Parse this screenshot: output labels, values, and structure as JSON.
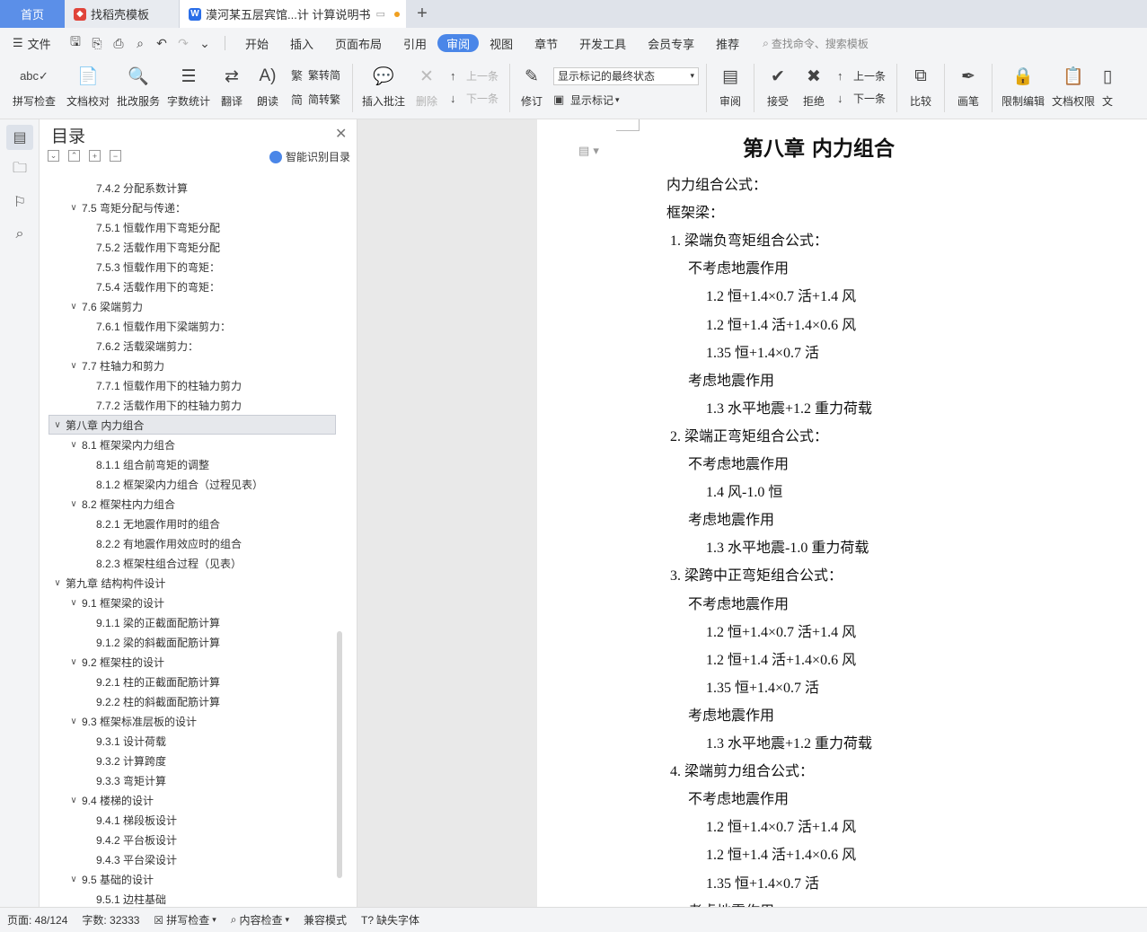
{
  "tabs": {
    "home": "首页",
    "t2": "找稻壳模板",
    "t3": "漠河某五层宾馆...计 计算说明书"
  },
  "menu": {
    "file": "文件",
    "items": [
      "开始",
      "插入",
      "页面布局",
      "引用",
      "审阅",
      "视图",
      "章节",
      "开发工具",
      "会员专享",
      "推荐"
    ],
    "active": "审阅",
    "search": "查找命令、搜索模板"
  },
  "ribbon": {
    "spell": "拼写检查",
    "proof": "文档校对",
    "batch": "批改服务",
    "wordcount": "字数统计",
    "translate": "翻译",
    "read": "朗读",
    "trad": "繁转简",
    "simp": "简转繁",
    "insert_comment": "插入批注",
    "delete": "删除",
    "prev": "上一条",
    "next": "下一条",
    "track": "修订",
    "markup_state": "显示标记的最终状态",
    "show_markup": "显示标记",
    "review": "审阅",
    "accept": "接受",
    "reject": "拒绝",
    "prev2": "上一条",
    "next2": "下一条",
    "compare": "比较",
    "pen": "画笔",
    "restrict": "限制编辑",
    "rights": "文档权限",
    "doc": "文"
  },
  "toc": {
    "title": "目录",
    "smart": "智能识别目录",
    "entries": [
      {
        "level": 3,
        "text": "7.4.2 分配系数计算"
      },
      {
        "level": 2,
        "text": "7.5 弯矩分配与传递："
      },
      {
        "level": 3,
        "text": "7.5.1 恒载作用下弯矩分配"
      },
      {
        "level": 3,
        "text": "7.5.2 活载作用下弯矩分配"
      },
      {
        "level": 3,
        "text": "7.5.3 恒载作用下的弯矩："
      },
      {
        "level": 3,
        "text": "7.5.4 活载作用下的弯矩："
      },
      {
        "level": 2,
        "text": "7.6 梁端剪力"
      },
      {
        "level": 3,
        "text": "7.6.1 恒载作用下梁端剪力："
      },
      {
        "level": 3,
        "text": "7.6.2 活载梁端剪力："
      },
      {
        "level": 2,
        "text": "7.7 柱轴力和剪力"
      },
      {
        "level": 3,
        "text": "7.7.1 恒载作用下的柱轴力剪力"
      },
      {
        "level": 3,
        "text": "7.7.2 活载作用下的柱轴力剪力"
      },
      {
        "level": 1,
        "text": "第八章  内力组合",
        "active": true
      },
      {
        "level": 2,
        "text": "8.1 框架梁内力组合"
      },
      {
        "level": 3,
        "text": "8.1.1 组合前弯矩的调整"
      },
      {
        "level": 3,
        "text": "8.1.2 框架梁内力组合（过程见表）"
      },
      {
        "level": 2,
        "text": "8.2 框架柱内力组合"
      },
      {
        "level": 3,
        "text": "8.2.1 无地震作用时的组合"
      },
      {
        "level": 3,
        "text": "8.2.2 有地震作用效应时的组合"
      },
      {
        "level": 3,
        "text": "8.2.3 框架柱组合过程（见表）"
      },
      {
        "level": 1,
        "text": "第九章  结构构件设计"
      },
      {
        "level": 2,
        "text": "9.1 框架梁的设计"
      },
      {
        "level": 3,
        "text": "9.1.1 梁的正截面配筋计算"
      },
      {
        "level": 3,
        "text": "9.1.2 梁的斜截面配筋计算"
      },
      {
        "level": 2,
        "text": "9.2 框架柱的设计"
      },
      {
        "level": 3,
        "text": "9.2.1 柱的正截面配筋计算"
      },
      {
        "level": 3,
        "text": "9.2.2 柱的斜截面配筋计算"
      },
      {
        "level": 2,
        "text": "9.3 框架标准层板的设计"
      },
      {
        "level": 3,
        "text": "9.3.1 设计荷载"
      },
      {
        "level": 3,
        "text": "9.3.2 计算跨度"
      },
      {
        "level": 3,
        "text": "9.3.3 弯矩计算"
      },
      {
        "level": 2,
        "text": "9.4 楼梯的设计"
      },
      {
        "level": 3,
        "text": "9.4.1 梯段板设计"
      },
      {
        "level": 3,
        "text": "9.4.2 平台板设计"
      },
      {
        "level": 3,
        "text": "9.4.3 平台梁设计"
      },
      {
        "level": 2,
        "text": " 9.5 基础的设计"
      },
      {
        "level": 3,
        "text": "9.5.1 边柱基础"
      }
    ]
  },
  "doc": {
    "heading": "第八章  内力组合",
    "lines": [
      {
        "indent": 0,
        "text": "内力组合公式："
      },
      {
        "indent": 0,
        "text": "框架梁："
      },
      {
        "indent": 1,
        "text": "1.  梁端负弯矩组合公式："
      },
      {
        "indent": 2,
        "text": "不考虑地震作用"
      },
      {
        "indent": 3,
        "text": "1.2 恒+1.4×0.7 活+1.4 风"
      },
      {
        "indent": 3,
        "text": "1.2 恒+1.4 活+1.4×0.6 风"
      },
      {
        "indent": 3,
        "text": "1.35 恒+1.4×0.7 活"
      },
      {
        "indent": 2,
        "text": "考虑地震作用"
      },
      {
        "indent": 3,
        "text": "1.3 水平地震+1.2 重力荷载"
      },
      {
        "indent": 1,
        "text": "2.  梁端正弯矩组合公式："
      },
      {
        "indent": 2,
        "text": "不考虑地震作用"
      },
      {
        "indent": 3,
        "text": "1.4 风-1.0 恒"
      },
      {
        "indent": 2,
        "text": "考虑地震作用"
      },
      {
        "indent": 3,
        "text": "1.3 水平地震-1.0 重力荷载"
      },
      {
        "indent": 1,
        "text": "3.  梁跨中正弯矩组合公式："
      },
      {
        "indent": 2,
        "text": "不考虑地震作用"
      },
      {
        "indent": 3,
        "text": "1.2 恒+1.4×0.7 活+1.4 风"
      },
      {
        "indent": 3,
        "text": "1.2 恒+1.4 活+1.4×0.6 风"
      },
      {
        "indent": 3,
        "text": "1.35 恒+1.4×0.7 活"
      },
      {
        "indent": 2,
        "text": "考虑地震作用"
      },
      {
        "indent": 3,
        "text": "1.3 水平地震+1.2 重力荷载"
      },
      {
        "indent": 1,
        "text": "4.  梁端剪力组合公式："
      },
      {
        "indent": 2,
        "text": "不考虑地震作用"
      },
      {
        "indent": 3,
        "text": "1.2 恒+1.4×0.7 活+1.4 风"
      },
      {
        "indent": 3,
        "text": "1.2 恒+1.4 活+1.4×0.6 风"
      },
      {
        "indent": 3,
        "text": "1.35 恒+1.4×0.7 活"
      },
      {
        "indent": 2,
        "text": "考虑地震作用"
      }
    ]
  },
  "status": {
    "page": "页面: 48/124",
    "words": "字数: 32333",
    "spell": "拼写检查",
    "content": "内容检查",
    "compat": "兼容模式",
    "font": "缺失字体"
  }
}
